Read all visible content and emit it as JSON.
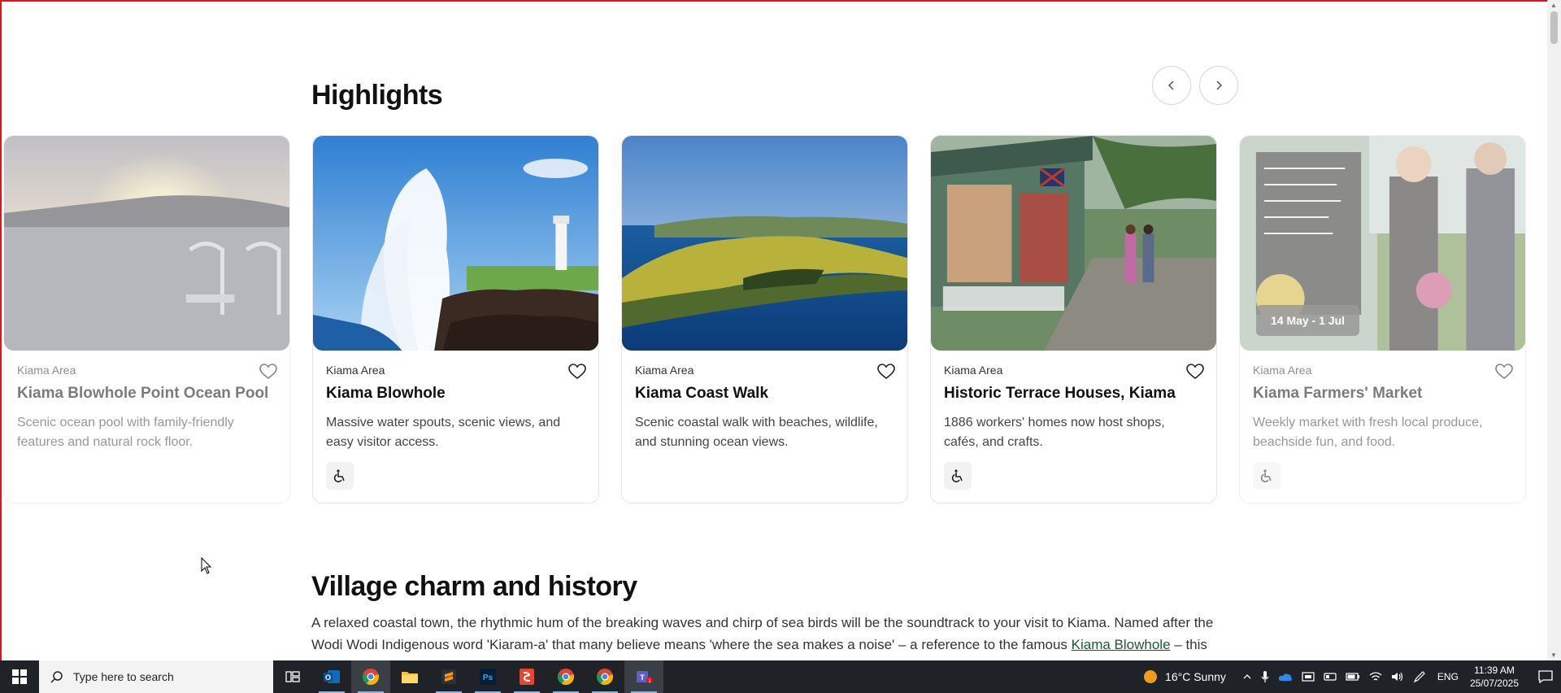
{
  "highlights": {
    "title": "Highlights",
    "prev_label": "‹",
    "next_label": "›",
    "cards": [
      {
        "area": "Kiama Area",
        "title": "Kiama Blowhole Point Ocean Pool",
        "description": "Scenic ocean pool with family-friendly features and natural rock floor.",
        "image": "ocean-pool-sunset-image",
        "accessible": false
      },
      {
        "area": "Kiama Area",
        "title": "Kiama Blowhole",
        "description": "Massive water spouts, scenic views, and easy visitor access.",
        "image": "blowhole-lighthouse-image",
        "accessible": true
      },
      {
        "area": "Kiama Area",
        "title": "Kiama Coast Walk",
        "description": "Scenic coastal walk with beaches, wildlife, and stunning ocean views.",
        "image": "coastal-headland-image",
        "accessible": false
      },
      {
        "area": "Kiama Area",
        "title": "Historic Terrace Houses, Kiama",
        "description": "1886 workers' homes now host shops, cafés, and crafts.",
        "image": "terrace-houses-image",
        "accessible": true
      },
      {
        "area": "Kiama Area",
        "title": "Kiama Farmers' Market",
        "description": "Weekly market with fresh local produce, beachside fun, and food.",
        "image": "farmers-market-image",
        "badge": "14 May - 1 Jul",
        "accessible": true
      }
    ]
  },
  "village": {
    "title": "Village charm and history",
    "text_1": "A relaxed coastal town, the rhythmic hum of the breaking waves and chirp of sea birds will be the soundtrack to your visit to Kiama. Named after the Wodi Wodi Indigenous word 'Kiaram-a' that many believe means 'where the sea makes a noise' – a reference to the famous ",
    "link": "Kiama Blowhole",
    "text_2": " – this"
  },
  "taskbar": {
    "search_placeholder": "Type here to search",
    "apps": [
      "task-view-icon",
      "outlook-icon",
      "chrome-icon",
      "file-explorer-icon",
      "sublime-icon",
      "photoshop-icon",
      "slides-icon",
      "chrome-profile-2-icon",
      "chrome-profile-3-icon",
      "teams-icon"
    ],
    "weather": "16°C  Sunny",
    "language": "ENG",
    "time": "11:39 AM",
    "date": "25/07/2025"
  },
  "colors": {
    "accent_link": "#1a5c2e",
    "frame": "#e8101a",
    "taskbar": "#1f2328"
  }
}
